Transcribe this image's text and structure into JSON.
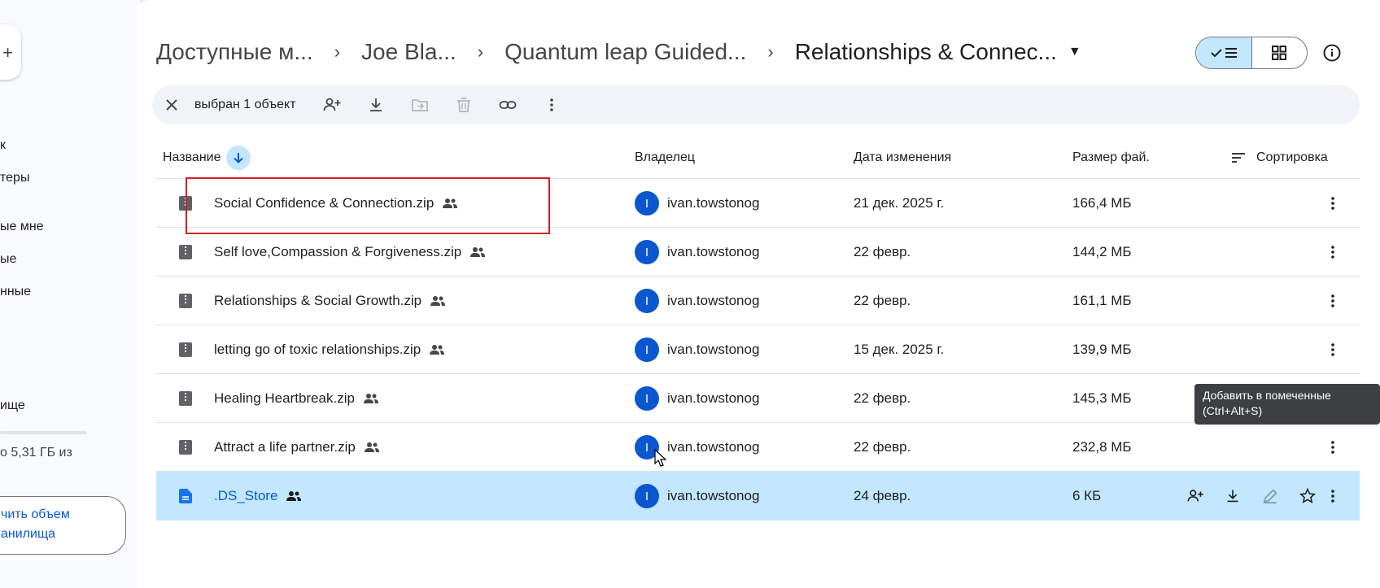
{
  "sidebar": {
    "items": [
      "к",
      "теры",
      "ые мне",
      "ые",
      "нные",
      "ище"
    ],
    "storage_text": "о 5,31 ГБ из",
    "upgrade_line1": "чить объем",
    "upgrade_line2": "анилища"
  },
  "breadcrumbs": [
    "Доступные м...",
    "Joe Bla...",
    "Quantum leap Guided...",
    "Relationships & Connec..."
  ],
  "actionbar": {
    "selected_text": "выбран 1 объект"
  },
  "table": {
    "headers": {
      "name": "Название",
      "owner": "Владелец",
      "date": "Дата изменения",
      "size": "Размер фай.",
      "sort": "Сортировка"
    },
    "rows": [
      {
        "name": "Social Confidence & Connection.zip",
        "owner": "ivan.towstonog",
        "avatar": "I",
        "date": "21 дек. 2025 г.",
        "size": "166,4 МБ",
        "type": "zip"
      },
      {
        "name": "Self love,Compassion & Forgiveness.zip",
        "owner": "ivan.towstonog",
        "avatar": "I",
        "date": "22 февр.",
        "size": "144,2 МБ",
        "type": "zip"
      },
      {
        "name": "Relationships & Social Growth.zip",
        "owner": "ivan.towstonog",
        "avatar": "I",
        "date": "22 февр.",
        "size": "161,1 МБ",
        "type": "zip"
      },
      {
        "name": "letting go of toxic relationships.zip",
        "owner": "ivan.towstonog",
        "avatar": "I",
        "date": "15 дек. 2025 г.",
        "size": "139,9 МБ",
        "type": "zip"
      },
      {
        "name": "Healing Heartbreak.zip",
        "owner": "ivan.towstonog",
        "avatar": "I",
        "date": "22 февр.",
        "size": "145,3 МБ",
        "type": "zip"
      },
      {
        "name": "Attract a life partner.zip",
        "owner": "ivan.towstonog",
        "avatar": "I",
        "date": "22 февр.",
        "size": "232,8 МБ",
        "type": "zip"
      },
      {
        "name": ".DS_Store",
        "owner": "ivan.towstonog",
        "avatar": "I",
        "date": "24 февр.",
        "size": "6 КБ",
        "type": "doc"
      }
    ]
  },
  "tooltip": {
    "line1": "Добавить в помеченные",
    "line2": "(Ctrl+Alt+S)"
  },
  "colors": {
    "accent": "#0b57d0",
    "selected_row": "#c2e7ff",
    "highlight": "#d81b25"
  }
}
